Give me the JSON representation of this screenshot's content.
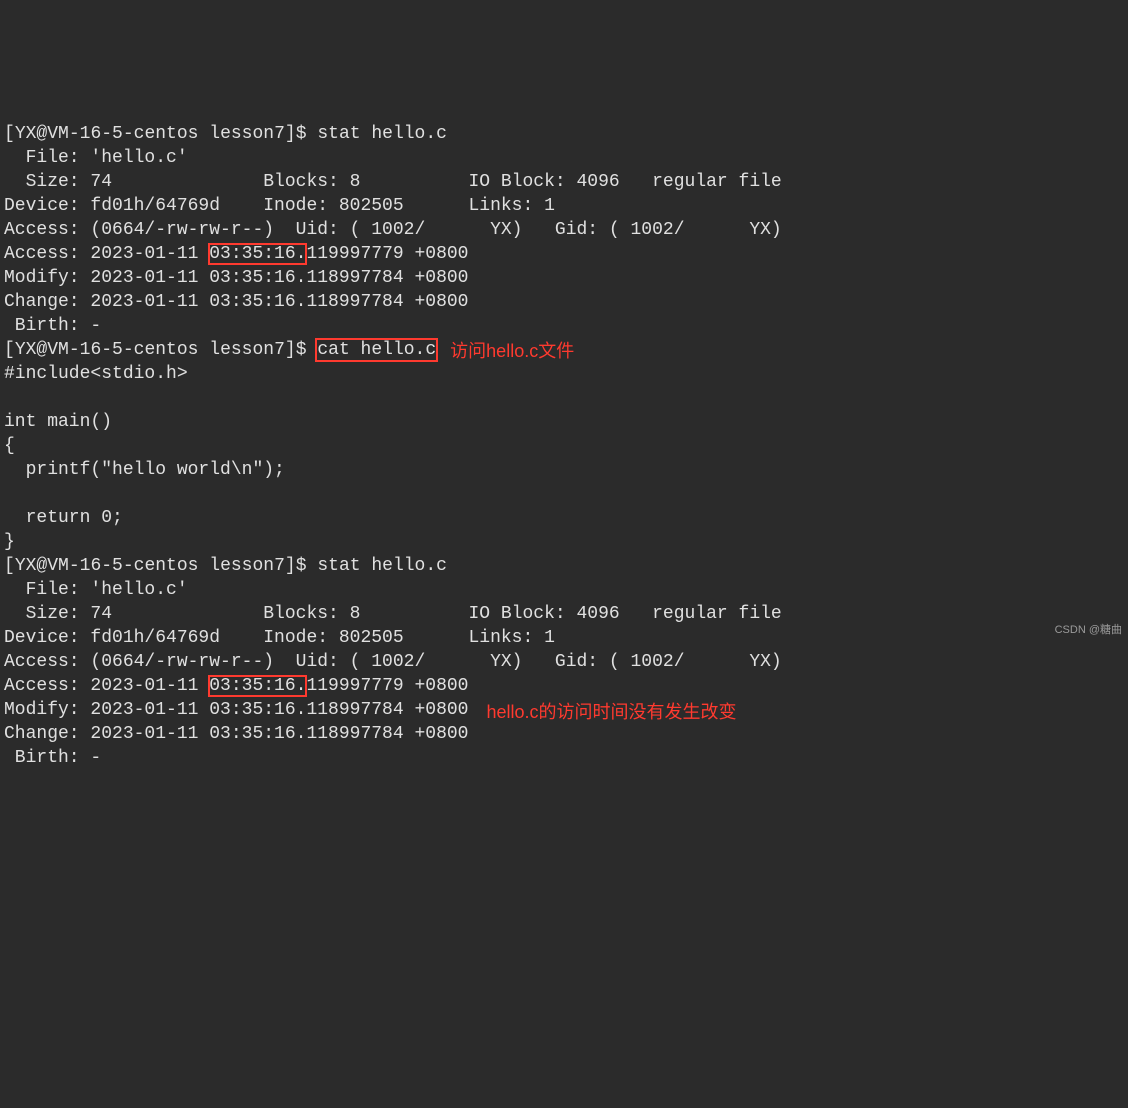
{
  "prompt1": {
    "user": "YX",
    "host": "VM-16-5-centos",
    "dir": "lesson7",
    "symbol": "$",
    "cmd": "stat hello.c"
  },
  "stat1": {
    "file": "  File: 'hello.c'",
    "size": "  Size: 74              Blocks: 8          IO Block: 4096   regular file",
    "dev": "Device: fd01h/64769d    Inode: 802505      Links: 1",
    "perm": "Access: (0664/-rw-rw-r--)  Uid: ( 1002/      YX)   Gid: ( 1002/      YX)",
    "acc_pre": "Access: 2023-01-11 ",
    "acc_hl": "03:35:16.",
    "acc_post": "119997779 +0800",
    "mod": "Modify: 2023-01-11 03:35:16.118997784 +0800",
    "chg": "Change: 2023-01-11 03:35:16.118997784 +0800",
    "birth": " Birth: -"
  },
  "prompt2": {
    "user": "YX",
    "host": "VM-16-5-centos",
    "dir": "lesson7",
    "symbol": "$",
    "cmd_pre": "",
    "cmd_hl": "cat hello.c"
  },
  "src": {
    "l1": "#include<stdio.h>",
    "l2": "",
    "l3": "int main()",
    "l4": "{",
    "l5": "  printf(\"hello world\\n\");",
    "l6": "",
    "l7": "  return 0;",
    "l8": "}"
  },
  "prompt3": {
    "user": "YX",
    "host": "VM-16-5-centos",
    "dir": "lesson7",
    "symbol": "$",
    "cmd": "stat hello.c"
  },
  "stat2": {
    "file": "  File: 'hello.c'",
    "size": "  Size: 74              Blocks: 8          IO Block: 4096   regular file",
    "dev": "Device: fd01h/64769d    Inode: 802505      Links: 1",
    "perm": "Access: (0664/-rw-rw-r--)  Uid: ( 1002/      YX)   Gid: ( 1002/      YX)",
    "acc_pre": "Access: 2023-01-11 ",
    "acc_hl": "03:35:16.",
    "acc_post": "119997779 +0800",
    "mod": "Modify: 2023-01-11 03:35:16.118997784 +0800",
    "chg": "Change: 2023-01-11 03:35:16.118997784 +0800",
    "birth": " Birth: -"
  },
  "annotations": {
    "a1": "访问hello.c文件",
    "a2": "hello.c的访问时间没有发生改变"
  },
  "watermark": "CSDN @糖曲"
}
